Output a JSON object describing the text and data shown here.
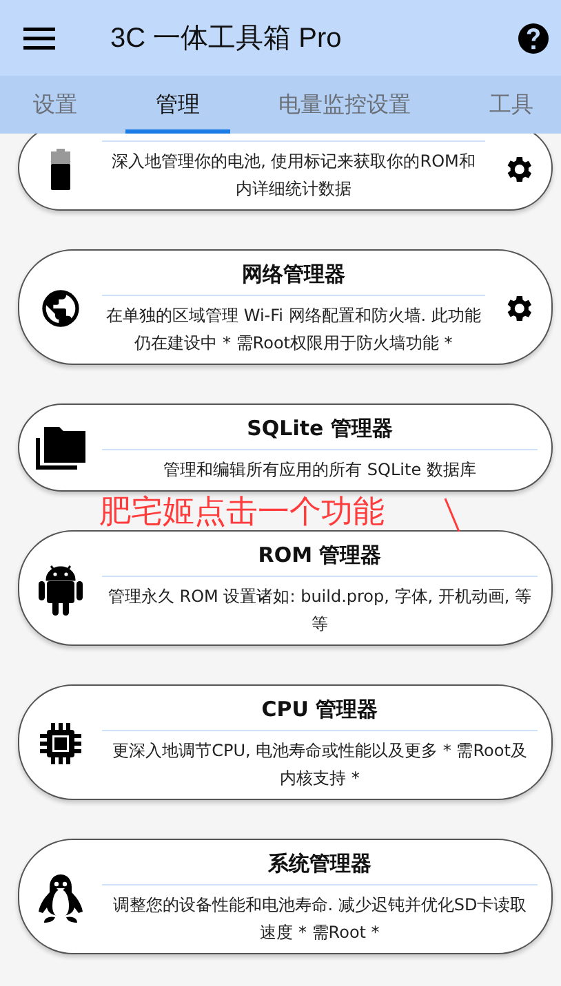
{
  "app_bar": {
    "title": "3C 一体工具箱 Pro"
  },
  "tabs": [
    {
      "label": "设置",
      "selected": false
    },
    {
      "label": "管理",
      "selected": true
    },
    {
      "label": "电量监控设置",
      "selected": false
    },
    {
      "label": "工具",
      "selected": false
    }
  ],
  "cards": [
    {
      "kind": "battery",
      "description": "深入地管理你的电池, 使用标记来获取你的ROM和内详细统计数据",
      "settings": true
    },
    {
      "kind": "globe",
      "title": "网络管理器",
      "description": "在单独的区域管理 Wi-Fi 网络配置和防火墙. 此功能仍在建设中 * 需Root权限用于防火墙功能 *",
      "settings": true
    },
    {
      "kind": "folders",
      "title": "SQLite 管理器",
      "description": "管理和编辑所有应用的所有 SQLite 数据库",
      "settings": false
    },
    {
      "kind": "android",
      "title": "ROM 管理器",
      "description": "管理永久 ROM 设置诸如: build.prop, 字体, 开机动画, 等等",
      "settings": false
    },
    {
      "kind": "chip",
      "title": "CPU 管理器",
      "description": "更深入地调节CPU, 电池寿命或性能以及更多 * 需Root及内核支持 *",
      "settings": false
    },
    {
      "kind": "penguin",
      "title": "系统管理器",
      "description": "调整您的设备性能和电池寿命. 减少迟钝并优化SD卡读取速度 * 需Root *",
      "settings": false
    }
  ],
  "annotation": {
    "text": "肥宅姬点击一个功能"
  }
}
